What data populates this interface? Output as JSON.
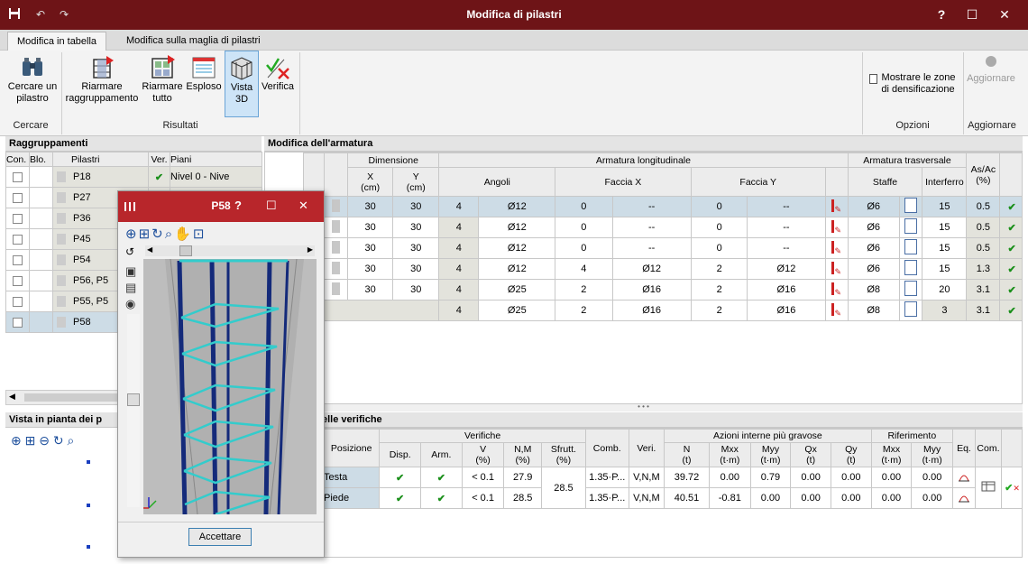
{
  "window": {
    "title": "Modifica di pilastri",
    "help": "?",
    "maximize": "☐",
    "close": "✕"
  },
  "tabs": [
    "Modifica in tabella",
    "Modifica sulla maglia di pilastri"
  ],
  "ribbon": {
    "search_btn": "Cercare un pilastro",
    "regroup_btn": "Riarmare raggruppamento",
    "rearm_all_btn": "Riarmare tutto",
    "exploded_btn": "Esploso",
    "view3d_btn": "Vista 3D",
    "verify_btn": "Verifica",
    "densify_btn": "Mostrare le zone di densificazione",
    "update_btn": "Aggiornare",
    "groups": [
      "Cercare",
      "Risultati",
      "Opzioni",
      "Aggiornare"
    ]
  },
  "left": {
    "title": "Raggruppamenti",
    "headers": [
      "Con.",
      "Blo.",
      "Pilastri",
      "Ver.",
      "Piani"
    ],
    "rows": [
      {
        "name": "P18",
        "ver": "✔",
        "piani": "Nivel 0 - Nive"
      },
      {
        "name": "P27",
        "ver": "",
        "piani": ""
      },
      {
        "name": "P36",
        "ver": "",
        "piani": ""
      },
      {
        "name": "P45",
        "ver": "",
        "piani": ""
      },
      {
        "name": "P54",
        "ver": "",
        "piani": ""
      },
      {
        "name": "P56, P5",
        "ver": "",
        "piani": ""
      },
      {
        "name": "P55, P5",
        "ver": "",
        "piani": ""
      },
      {
        "name": "P58",
        "ver": "",
        "piani": ""
      }
    ],
    "plan_title": "Vista in pianta dei p"
  },
  "main": {
    "title": "Modifica dell'armatura",
    "h_dim": "Dimensione",
    "h_x": "X",
    "h_y": "Y",
    "h_cm": "(cm)",
    "h_long": "Armatura longitudinale",
    "h_angoli": "Angoli",
    "h_fx": "Faccia X",
    "h_fy": "Faccia Y",
    "h_trasv": "Armatura trasversale",
    "h_staffe": "Staffe",
    "h_interf": "Interferro",
    "h_asac": "As/Ac",
    "h_pct": "(%)",
    "rows": [
      {
        "pre": "m",
        "x": "30",
        "y": "30",
        "n": "4",
        "ang": "Ø12",
        "fxn": "0",
        "fxd": "--",
        "fyn": "0",
        "fyd": "--",
        "st": "Ø6",
        "int": "15",
        "as": "0.5",
        "sel": true
      },
      {
        "pre": "m",
        "x": "30",
        "y": "30",
        "n": "4",
        "ang": "Ø12",
        "fxn": "0",
        "fxd": "--",
        "fyn": "0",
        "fyd": "--",
        "st": "Ø6",
        "int": "15",
        "as": "0.5"
      },
      {
        "pre": "m",
        "x": "30",
        "y": "30",
        "n": "4",
        "ang": "Ø12",
        "fxn": "0",
        "fxd": "--",
        "fyn": "0",
        "fyd": "--",
        "st": "Ø6",
        "int": "15",
        "as": "0.5"
      },
      {
        "pre": "m",
        "x": "30",
        "y": "30",
        "n": "4",
        "ang": "Ø12",
        "fxn": "4",
        "fxd": "Ø12",
        "fyn": "2",
        "fyd": "Ø12",
        "st": "Ø6",
        "int": "15",
        "as": "1.3"
      },
      {
        "pre": "m",
        "x": "30",
        "y": "30",
        "n": "4",
        "ang": "Ø25",
        "fxn": "2",
        "fxd": "Ø16",
        "fyn": "2",
        "fyd": "Ø16",
        "st": "Ø8",
        "int": "20",
        "as": "3.1"
      },
      {
        "pre": "m",
        "x": "",
        "y": "",
        "n": "4",
        "ang": "Ø25",
        "fxn": "2",
        "fxd": "Ø16",
        "fyn": "2",
        "fyd": "Ø16",
        "st": "Ø8",
        "int": "3",
        "as": "3.1"
      }
    ]
  },
  "verif": {
    "title": "elle verifiche",
    "h_pos": "Posizione",
    "h_verifiche": "Verifiche",
    "h_disp": "Disp.",
    "h_arm": "Arm.",
    "h_v": "V",
    "h_nm": "N,M",
    "h_sfrutt": "Sfrutt.",
    "h_pct": "(%)",
    "h_comb": "Comb.",
    "h_veri": "Veri.",
    "h_azioni": "Azioni interne più gravose",
    "h_n": "N",
    "h_t": "(t)",
    "h_mxx": "Mxx",
    "h_myy": "Myy",
    "h_tm": "(t·m)",
    "h_qx": "Qx",
    "h_qy": "Qy",
    "h_rif": "Riferimento",
    "h_eq": "Eq.",
    "h_com": "Com.",
    "sfrutt": "28.5",
    "rows": [
      {
        "pos": "Testa",
        "v": "< 0.1",
        "nm": "27.9",
        "comb": "1.35·P...",
        "veri": "V,N,M",
        "n": "39.72",
        "mxx": "0.00",
        "myy": "0.79",
        "qx": "0.00",
        "qy": "0.00",
        "rmxx": "0.00",
        "rmyy": "0.00"
      },
      {
        "pos": "Piede",
        "v": "< 0.1",
        "nm": "28.5",
        "comb": "1.35·P...",
        "veri": "V,N,M",
        "n": "40.51",
        "mxx": "-0.81",
        "myy": "0.00",
        "qx": "0.00",
        "qy": "0.00",
        "rmxx": "0.00",
        "rmyy": "0.00"
      }
    ]
  },
  "dialog": {
    "title": "P58",
    "help": "?",
    "accept": "Accettare"
  }
}
